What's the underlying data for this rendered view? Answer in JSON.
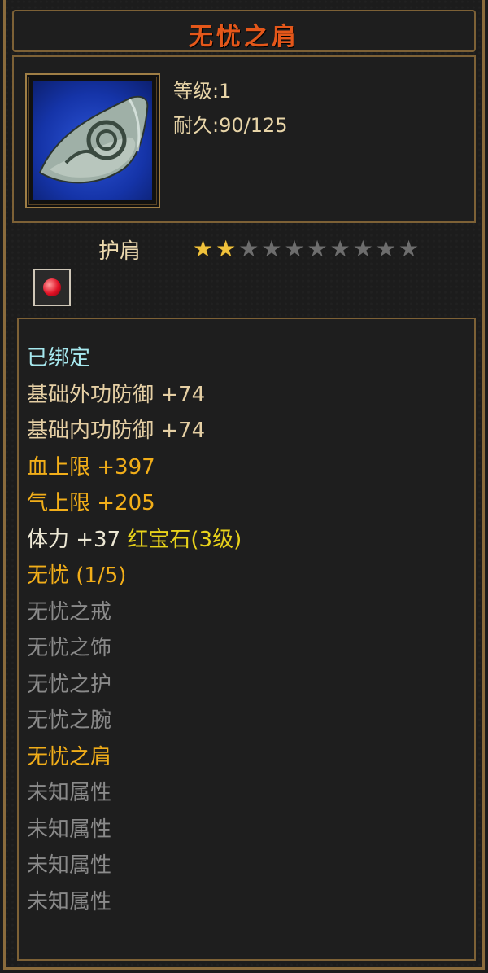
{
  "title": "无忧之肩",
  "item": {
    "level": "等级:1",
    "durability": "耐久:90/125",
    "icon": "shoulder-armor-icon"
  },
  "slot": {
    "label": "护肩",
    "stars_filled": 2,
    "stars_total": 10,
    "gem_icon": "ruby-gem-icon"
  },
  "attributes": {
    "bound": "已绑定",
    "outer_def": "基础外功防御 +74",
    "inner_def": "基础内功防御 +74",
    "hp": "血上限 +397",
    "qi": "气上限 +205",
    "stamina": "体力 +37",
    "gem": "红宝石(3级)",
    "set_name": "无忧 (1/5)",
    "set_items": [
      {
        "name": "无忧之戒",
        "active": false
      },
      {
        "name": "无忧之饰",
        "active": false
      },
      {
        "name": "无忧之护",
        "active": false
      },
      {
        "name": "无忧之腕",
        "active": false
      },
      {
        "name": "无忧之肩",
        "active": true
      }
    ],
    "unknown": [
      "未知属性",
      "未知属性",
      "未知属性",
      "未知属性"
    ]
  },
  "colors": {
    "title": "#e4571a",
    "gold": "#f2ae19",
    "cyan": "#a6e8ee",
    "inactive": "#8a8a8a",
    "frame": "#8a6b3c"
  }
}
